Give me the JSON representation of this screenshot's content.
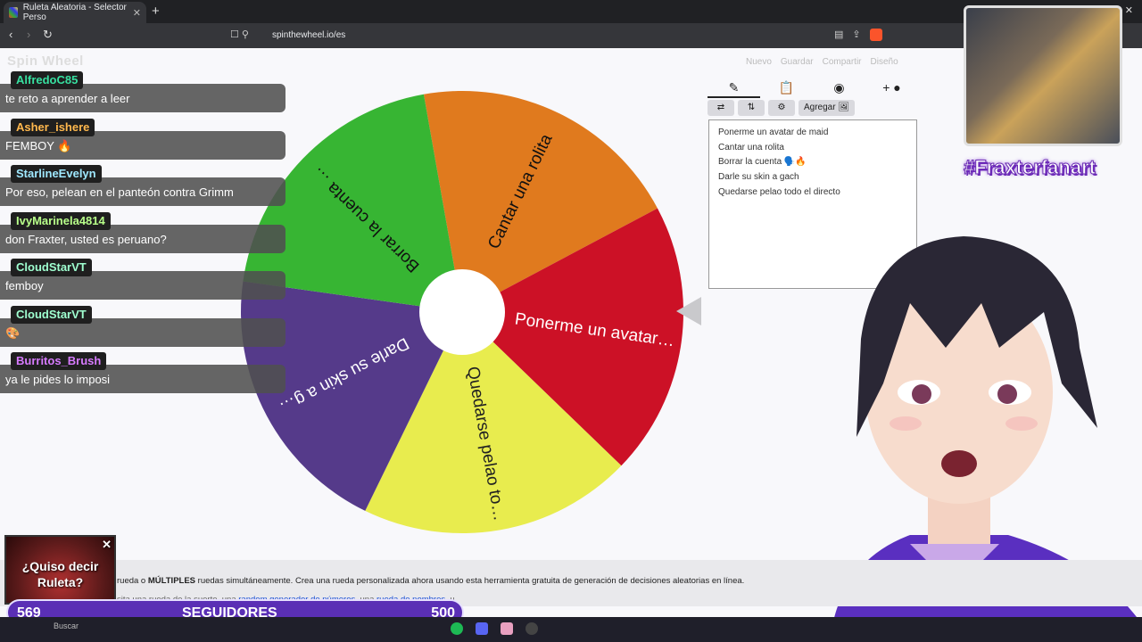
{
  "browser": {
    "tab_title": "Ruleta Aleatoria - Selector Perso",
    "tab_close": "✕",
    "new_tab": "+",
    "url": "spinthewheel.io/es",
    "window_controls": [
      "—",
      "▢",
      "✕"
    ]
  },
  "site": {
    "logo": "Spin Wheel",
    "menu": [
      "Nuevo",
      "Guardar",
      "Compartir",
      "Diseño"
    ]
  },
  "chat": [
    {
      "user": "AlfredoC85",
      "color": "#37e0a0",
      "text": "te reto a aprender a leer"
    },
    {
      "user": "Asher_ishere",
      "color": "#ffb84d",
      "text": "FEMBOY 🔥"
    },
    {
      "user": "StarlineEvelyn",
      "color": "#9fe8ff",
      "text": "Por eso, pelean en el panteón contra Grimm"
    },
    {
      "user": "IvyMarinela4814",
      "color": "#b8ff8a",
      "text": "don Fraxter, usted es peruano?"
    },
    {
      "user": "CloudStarVT",
      "color": "#9fffd0",
      "text": "femboy"
    },
    {
      "user": "CloudStarVT",
      "color": "#9fffd0",
      "text": "🎨"
    },
    {
      "user": "Burritos_Brush",
      "color": "#d77bff",
      "text": "ya le pides lo imposi"
    }
  ],
  "wheel": {
    "segments": [
      {
        "label": "Cantar una rolita",
        "color": "#e07a1e"
      },
      {
        "label": "Ponerme un avatar…",
        "color": "#cc1126"
      },
      {
        "label": "Quedarse pelao to…",
        "color": "#e8ec4e"
      },
      {
        "label": "Darle su skin a g…",
        "color": "#553a8a"
      },
      {
        "label": "Borrar la cuenta …",
        "color": "#37b533"
      }
    ]
  },
  "editor": {
    "tabs": [
      "✎",
      "📋",
      "◉",
      "+ ●"
    ],
    "tools": [
      "⇄",
      "⇅",
      "⚙",
      "Agregar 🖼"
    ],
    "entries": [
      "Ponerme un avatar de maid",
      "Cantar una rolita",
      "Borrar la cuenta 🗣️🔥",
      "Darle su skin a gach",
      "Quedarse pelao todo el directo"
    ]
  },
  "overlay": {
    "hashtag": "#Fraxterfanart",
    "promo": "¿Quiso decir Ruleta?",
    "promo_close": "✕",
    "followers_left": "569",
    "followers_label": "SEGUIDORES",
    "followers_right": "500"
  },
  "footer": {
    "line1_pre": "rueda o ",
    "line1_bold": "MÚLTIPLES",
    "line1_post": " ruedas simultáneamente. Crea una rueda personalizada ahora usando esta herramienta gratuita de generación de decisiones aleatorias en línea.",
    "line2_pre": "sita una rueda de la suerte, una ",
    "link1": "random generador de números",
    "line2_mid": ", una ",
    "link2": "rueda de nombres",
    "line2_post": ", u"
  },
  "taskbar": {
    "search": "Buscar"
  }
}
